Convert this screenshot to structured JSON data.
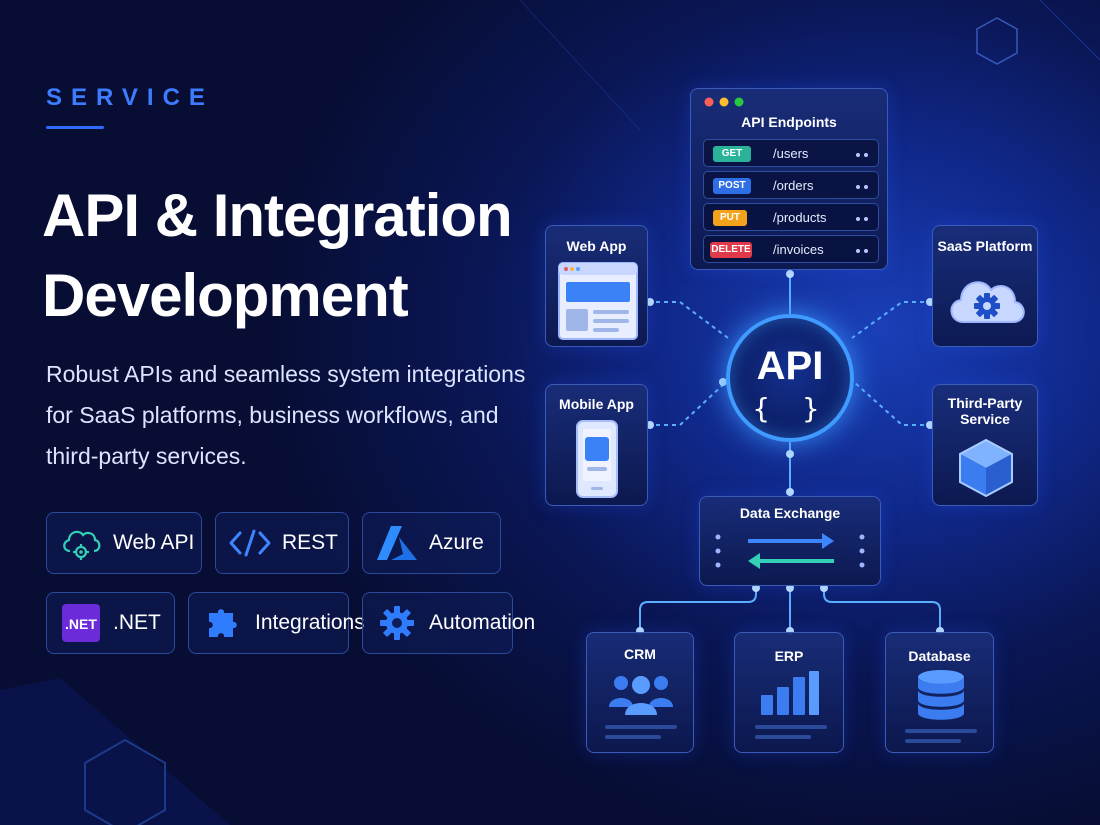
{
  "header": {
    "eyebrow": "SERVICE",
    "title_line1": "API & Integration",
    "title_line2": "Development",
    "subtitle": "Robust APIs and seamless system integrations for SaaS platforms, business workflows, and third-party services."
  },
  "chips": [
    {
      "label": "Web API",
      "icon": "cloud-gear-icon"
    },
    {
      "label": "REST",
      "icon": "code-brackets-icon"
    },
    {
      "label": "Azure",
      "icon": "azure-logo-icon"
    },
    {
      "label": ".NET",
      "icon": "dotnet-logo-icon",
      "icon_text": ".NET"
    },
    {
      "label": "Integrations",
      "icon": "puzzle-icon"
    },
    {
      "label": "Automation",
      "icon": "gear-icon"
    }
  ],
  "endpoints": {
    "title": "API Endpoints",
    "rows": [
      {
        "method": "GET",
        "path": "/users",
        "color": "#2bb39a"
      },
      {
        "method": "POST",
        "path": "/orders",
        "color": "#2f6fe6"
      },
      {
        "method": "PUT",
        "path": "/products",
        "color": "#f2a21b"
      },
      {
        "method": "DELETE",
        "path": "/invoices",
        "color": "#e03a4a"
      }
    ]
  },
  "hub": {
    "label": "API",
    "braces": "{ }"
  },
  "nodes": {
    "web_app": "Web App",
    "mobile_app": "Mobile App",
    "saas_platform": "SaaS Platform",
    "third_party_line1": "Third-Party",
    "third_party_line2": "Service",
    "data_exchange": "Data Exchange",
    "crm": "CRM",
    "erp": "ERP",
    "database": "Database"
  },
  "colors": {
    "accent": "#2f6bff",
    "glow": "#3f9bff",
    "card_border": "#3a5bb8"
  }
}
